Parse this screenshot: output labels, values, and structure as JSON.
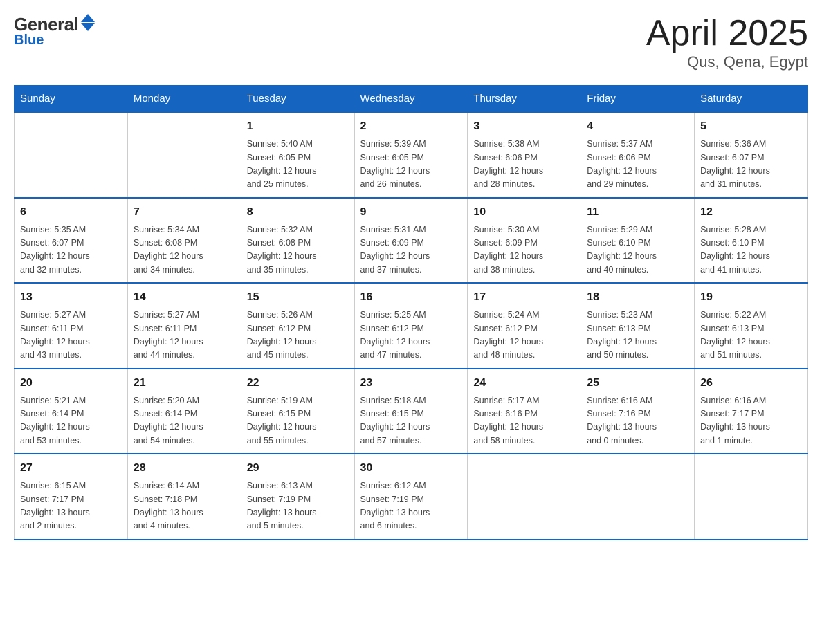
{
  "header": {
    "logo_general": "General",
    "logo_blue": "Blue",
    "month_title": "April 2025",
    "location": "Qus, Qena, Egypt"
  },
  "days_of_week": [
    "Sunday",
    "Monday",
    "Tuesday",
    "Wednesday",
    "Thursday",
    "Friday",
    "Saturday"
  ],
  "weeks": [
    [
      {
        "day": "",
        "info": ""
      },
      {
        "day": "",
        "info": ""
      },
      {
        "day": "1",
        "info": "Sunrise: 5:40 AM\nSunset: 6:05 PM\nDaylight: 12 hours\nand 25 minutes."
      },
      {
        "day": "2",
        "info": "Sunrise: 5:39 AM\nSunset: 6:05 PM\nDaylight: 12 hours\nand 26 minutes."
      },
      {
        "day": "3",
        "info": "Sunrise: 5:38 AM\nSunset: 6:06 PM\nDaylight: 12 hours\nand 28 minutes."
      },
      {
        "day": "4",
        "info": "Sunrise: 5:37 AM\nSunset: 6:06 PM\nDaylight: 12 hours\nand 29 minutes."
      },
      {
        "day": "5",
        "info": "Sunrise: 5:36 AM\nSunset: 6:07 PM\nDaylight: 12 hours\nand 31 minutes."
      }
    ],
    [
      {
        "day": "6",
        "info": "Sunrise: 5:35 AM\nSunset: 6:07 PM\nDaylight: 12 hours\nand 32 minutes."
      },
      {
        "day": "7",
        "info": "Sunrise: 5:34 AM\nSunset: 6:08 PM\nDaylight: 12 hours\nand 34 minutes."
      },
      {
        "day": "8",
        "info": "Sunrise: 5:32 AM\nSunset: 6:08 PM\nDaylight: 12 hours\nand 35 minutes."
      },
      {
        "day": "9",
        "info": "Sunrise: 5:31 AM\nSunset: 6:09 PM\nDaylight: 12 hours\nand 37 minutes."
      },
      {
        "day": "10",
        "info": "Sunrise: 5:30 AM\nSunset: 6:09 PM\nDaylight: 12 hours\nand 38 minutes."
      },
      {
        "day": "11",
        "info": "Sunrise: 5:29 AM\nSunset: 6:10 PM\nDaylight: 12 hours\nand 40 minutes."
      },
      {
        "day": "12",
        "info": "Sunrise: 5:28 AM\nSunset: 6:10 PM\nDaylight: 12 hours\nand 41 minutes."
      }
    ],
    [
      {
        "day": "13",
        "info": "Sunrise: 5:27 AM\nSunset: 6:11 PM\nDaylight: 12 hours\nand 43 minutes."
      },
      {
        "day": "14",
        "info": "Sunrise: 5:27 AM\nSunset: 6:11 PM\nDaylight: 12 hours\nand 44 minutes."
      },
      {
        "day": "15",
        "info": "Sunrise: 5:26 AM\nSunset: 6:12 PM\nDaylight: 12 hours\nand 45 minutes."
      },
      {
        "day": "16",
        "info": "Sunrise: 5:25 AM\nSunset: 6:12 PM\nDaylight: 12 hours\nand 47 minutes."
      },
      {
        "day": "17",
        "info": "Sunrise: 5:24 AM\nSunset: 6:12 PM\nDaylight: 12 hours\nand 48 minutes."
      },
      {
        "day": "18",
        "info": "Sunrise: 5:23 AM\nSunset: 6:13 PM\nDaylight: 12 hours\nand 50 minutes."
      },
      {
        "day": "19",
        "info": "Sunrise: 5:22 AM\nSunset: 6:13 PM\nDaylight: 12 hours\nand 51 minutes."
      }
    ],
    [
      {
        "day": "20",
        "info": "Sunrise: 5:21 AM\nSunset: 6:14 PM\nDaylight: 12 hours\nand 53 minutes."
      },
      {
        "day": "21",
        "info": "Sunrise: 5:20 AM\nSunset: 6:14 PM\nDaylight: 12 hours\nand 54 minutes."
      },
      {
        "day": "22",
        "info": "Sunrise: 5:19 AM\nSunset: 6:15 PM\nDaylight: 12 hours\nand 55 minutes."
      },
      {
        "day": "23",
        "info": "Sunrise: 5:18 AM\nSunset: 6:15 PM\nDaylight: 12 hours\nand 57 minutes."
      },
      {
        "day": "24",
        "info": "Sunrise: 5:17 AM\nSunset: 6:16 PM\nDaylight: 12 hours\nand 58 minutes."
      },
      {
        "day": "25",
        "info": "Sunrise: 6:16 AM\nSunset: 7:16 PM\nDaylight: 13 hours\nand 0 minutes."
      },
      {
        "day": "26",
        "info": "Sunrise: 6:16 AM\nSunset: 7:17 PM\nDaylight: 13 hours\nand 1 minute."
      }
    ],
    [
      {
        "day": "27",
        "info": "Sunrise: 6:15 AM\nSunset: 7:17 PM\nDaylight: 13 hours\nand 2 minutes."
      },
      {
        "day": "28",
        "info": "Sunrise: 6:14 AM\nSunset: 7:18 PM\nDaylight: 13 hours\nand 4 minutes."
      },
      {
        "day": "29",
        "info": "Sunrise: 6:13 AM\nSunset: 7:19 PM\nDaylight: 13 hours\nand 5 minutes."
      },
      {
        "day": "30",
        "info": "Sunrise: 6:12 AM\nSunset: 7:19 PM\nDaylight: 13 hours\nand 6 minutes."
      },
      {
        "day": "",
        "info": ""
      },
      {
        "day": "",
        "info": ""
      },
      {
        "day": "",
        "info": ""
      }
    ]
  ]
}
